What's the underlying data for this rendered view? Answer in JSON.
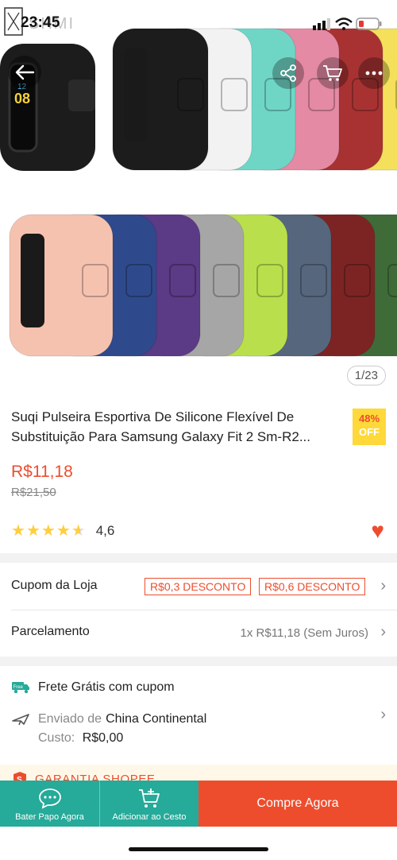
{
  "status": {
    "time": "23:45",
    "watermark": "SHMI"
  },
  "gallery": {
    "counter": "1/23"
  },
  "product": {
    "title": "Suqi Pulseira Esportiva De Silicone Flexível De Substituição Para Samsung Galaxy Fit 2 Sm-R2...",
    "discount_pct": "48%",
    "discount_off": "OFF",
    "price": "R$11,18",
    "old_price": "R$21,50",
    "rating": "4,6",
    "stars": 4.6
  },
  "coupon": {
    "label": "Cupom da Loja",
    "tags": [
      "R$0,3 DESCONTO",
      "R$0,6 DESCONTO"
    ]
  },
  "installment": {
    "label": "Parcelamento",
    "value": "1x R$11,18 (Sem Juros)"
  },
  "shipping": {
    "free_label": "Frete Grátis com cupom",
    "free_icon_text": "Free",
    "sent_from_label": "Enviado de",
    "sent_from": "China Continental",
    "cost_label": "Custo:",
    "cost": "R$0,00"
  },
  "guarantee": {
    "label": "GARANTIA SHOPEE"
  },
  "bottom_bar": {
    "chat_label": "Bater Papo Agora",
    "cart_label": "Adicionar ao Cesto",
    "buy_label": "Compre Agora"
  },
  "colors": {
    "accent": "#ee4d2d",
    "teal": "#26aa99",
    "badge": "#ffd839"
  },
  "band_colors_top": [
    "#1c1c1c",
    "#f2f2f2",
    "#6fd6c6",
    "#e58aa4",
    "#a83232",
    "#f4e05a"
  ],
  "band_colors_bottom": [
    "#f6c2b0",
    "#2f4a8c",
    "#5b3a86",
    "#a6a6a6",
    "#b9e04c",
    "#56677d",
    "#7c2424",
    "#3f6b39"
  ]
}
